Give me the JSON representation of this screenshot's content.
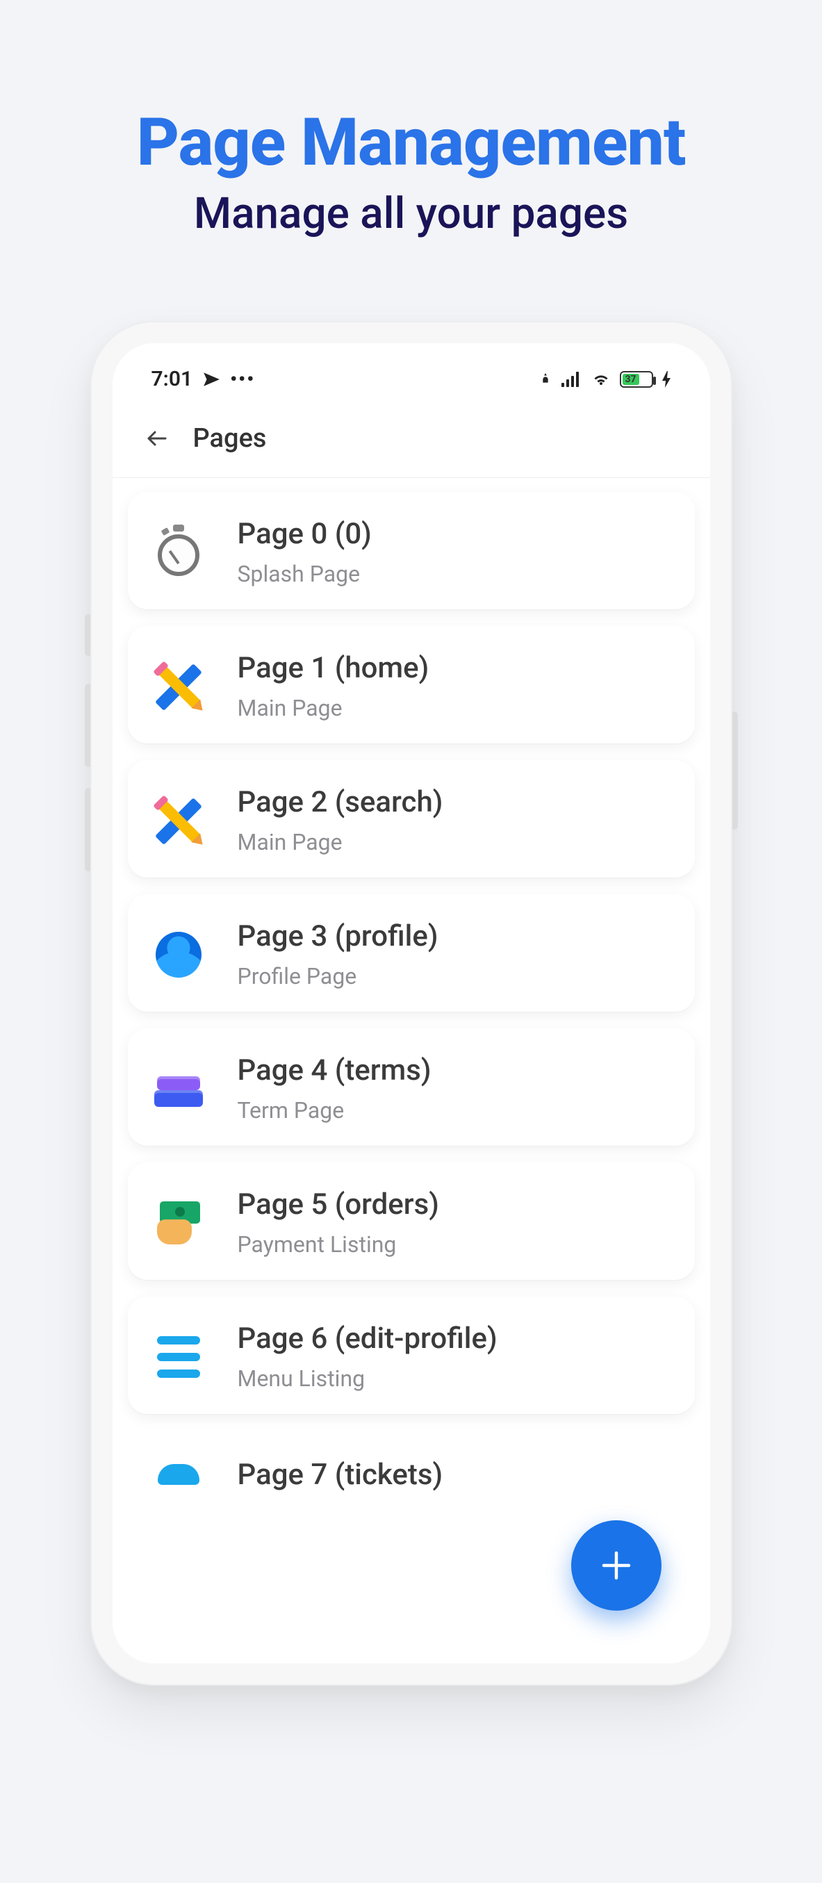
{
  "hero": {
    "title": "Page Management",
    "subtitle": "Manage all your pages"
  },
  "statusbar": {
    "time": "7:01",
    "battery_text": "37"
  },
  "appbar": {
    "title": "Pages"
  },
  "pages": [
    {
      "title": "Page 0 (0)",
      "subtitle": "Splash Page",
      "icon": "stopwatch"
    },
    {
      "title": "Page 1 (home)",
      "subtitle": "Main Page",
      "icon": "pencilruler"
    },
    {
      "title": "Page 2 (search)",
      "subtitle": "Main Page",
      "icon": "pencilruler"
    },
    {
      "title": "Page 3 (profile)",
      "subtitle": "Profile Page",
      "icon": "profile"
    },
    {
      "title": "Page 4 (terms)",
      "subtitle": "Term Page",
      "icon": "books"
    },
    {
      "title": "Page 5 (orders)",
      "subtitle": "Payment Listing",
      "icon": "money"
    },
    {
      "title": "Page 6 (edit-profile)",
      "subtitle": "Menu Listing",
      "icon": "menu"
    },
    {
      "title": "Page 7 (tickets)",
      "subtitle": "",
      "icon": "ticket",
      "partial": true
    }
  ],
  "fab": {
    "label": "add"
  }
}
